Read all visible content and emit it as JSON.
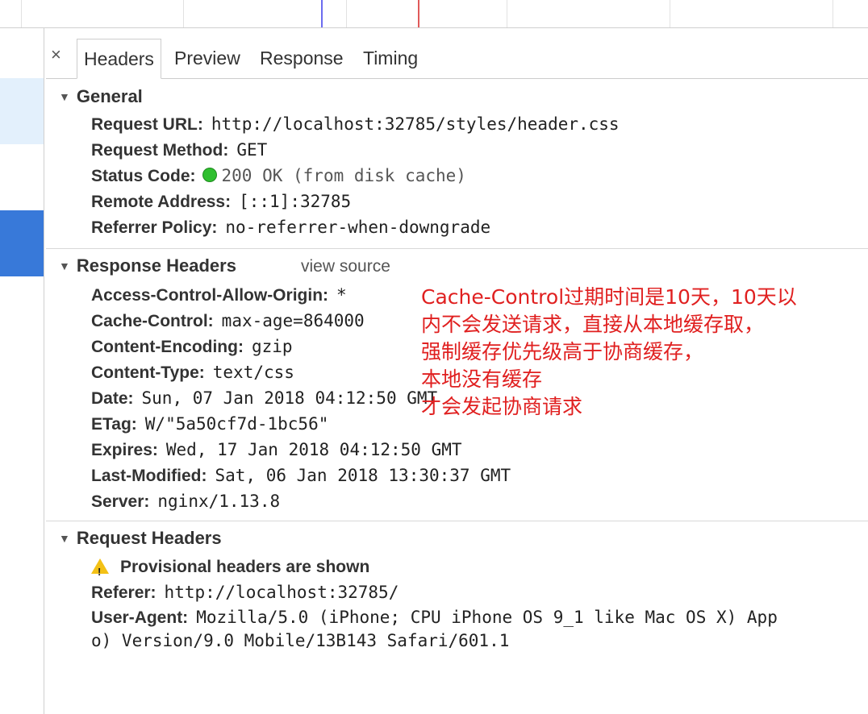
{
  "tabs": [
    "Headers",
    "Preview",
    "Response",
    "Timing"
  ],
  "close_glyph": "×",
  "general": {
    "title": "General",
    "rows": [
      {
        "key": "Request URL:",
        "value": "http://localhost:32785/styles/header.css"
      },
      {
        "key": "Request Method:",
        "value": "GET"
      },
      {
        "key": "Status Code:",
        "value": "200 OK (from disk cache)"
      },
      {
        "key": "Remote Address:",
        "value": "[::1]:32785"
      },
      {
        "key": "Referrer Policy:",
        "value": "no-referrer-when-downgrade"
      }
    ]
  },
  "response_headers": {
    "title": "Response Headers",
    "view_source": "view source",
    "rows": [
      {
        "key": "Access-Control-Allow-Origin:",
        "value": "*"
      },
      {
        "key": "Cache-Control:",
        "value": "max-age=864000"
      },
      {
        "key": "Content-Encoding:",
        "value": "gzip"
      },
      {
        "key": "Content-Type:",
        "value": "text/css"
      },
      {
        "key": "Date:",
        "value": "Sun, 07 Jan 2018 04:12:50 GMT"
      },
      {
        "key": "ETag:",
        "value": "W/\"5a50cf7d-1bc56\""
      },
      {
        "key": "Expires:",
        "value": "Wed, 17 Jan 2018 04:12:50 GMT"
      },
      {
        "key": "Last-Modified:",
        "value": "Sat, 06 Jan 2018 13:30:37 GMT"
      },
      {
        "key": "Server:",
        "value": "nginx/1.13.8"
      }
    ]
  },
  "request_headers": {
    "title": "Request Headers",
    "warning": "Provisional headers are shown",
    "rows": [
      {
        "key": "Referer:",
        "value": "http://localhost:32785/"
      },
      {
        "key": "User-Agent:",
        "value": "Mozilla/5.0 (iPhone; CPU iPhone OS 9_1 like Mac OS X) App"
      }
    ],
    "ua_continuation": "o) Version/9.0 Mobile/13B143 Safari/601.1"
  },
  "annotation": "Cache-Control过期时间是10天，10天以\n内不会发送请求，直接从本地缓存取，\n强制缓存优先级高于协商缓存，\n本地没有缓存\n才会发起协商请求",
  "colors": {
    "status_dot": "#2fbf2f",
    "annotation": "#e02020",
    "selected_row": "#3879d9",
    "warning": "#f3c116"
  }
}
